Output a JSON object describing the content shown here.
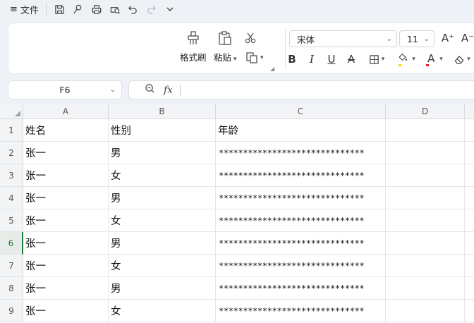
{
  "topbar": {
    "menu_icon": "≡",
    "menu_label": "文件",
    "icons": [
      "save-icon",
      "export-pdf-icon",
      "print-icon",
      "print-preview-icon",
      "undo-icon",
      "redo-icon",
      "more-chevron-icon"
    ]
  },
  "ribbon": {
    "format_painter_label": "格式刷",
    "paste_label": "粘贴",
    "font_name": "宋体",
    "font_size": "11",
    "increase_font": "A⁺",
    "decrease_font": "A⁻",
    "bold": "B",
    "italic": "I",
    "underline": "U",
    "strike": "A",
    "font_color_letter": "A",
    "fill_color": "#ffd200",
    "font_color": "#e02020"
  },
  "formula_bar": {
    "cell_ref": "F6",
    "fx_label": "fx",
    "content": ""
  },
  "grid": {
    "columns": [
      "A",
      "B",
      "C",
      "D"
    ],
    "rows": [
      {
        "num": "1",
        "cells": [
          "姓名",
          "性别",
          "年龄",
          ""
        ]
      },
      {
        "num": "2",
        "cells": [
          "张一",
          "男",
          "******************************",
          ""
        ]
      },
      {
        "num": "3",
        "cells": [
          "张一",
          "女",
          "******************************",
          ""
        ]
      },
      {
        "num": "4",
        "cells": [
          "张一",
          "男",
          "******************************",
          ""
        ]
      },
      {
        "num": "5",
        "cells": [
          "张一",
          "女",
          "******************************",
          ""
        ]
      },
      {
        "num": "6",
        "cells": [
          "张一",
          "男",
          "******************************",
          ""
        ]
      },
      {
        "num": "7",
        "cells": [
          "张一",
          "女",
          "******************************",
          ""
        ]
      },
      {
        "num": "8",
        "cells": [
          "张一",
          "男",
          "******************************",
          ""
        ]
      },
      {
        "num": "9",
        "cells": [
          "张一",
          "女",
          "******************************",
          ""
        ]
      }
    ],
    "active_row": "6"
  }
}
